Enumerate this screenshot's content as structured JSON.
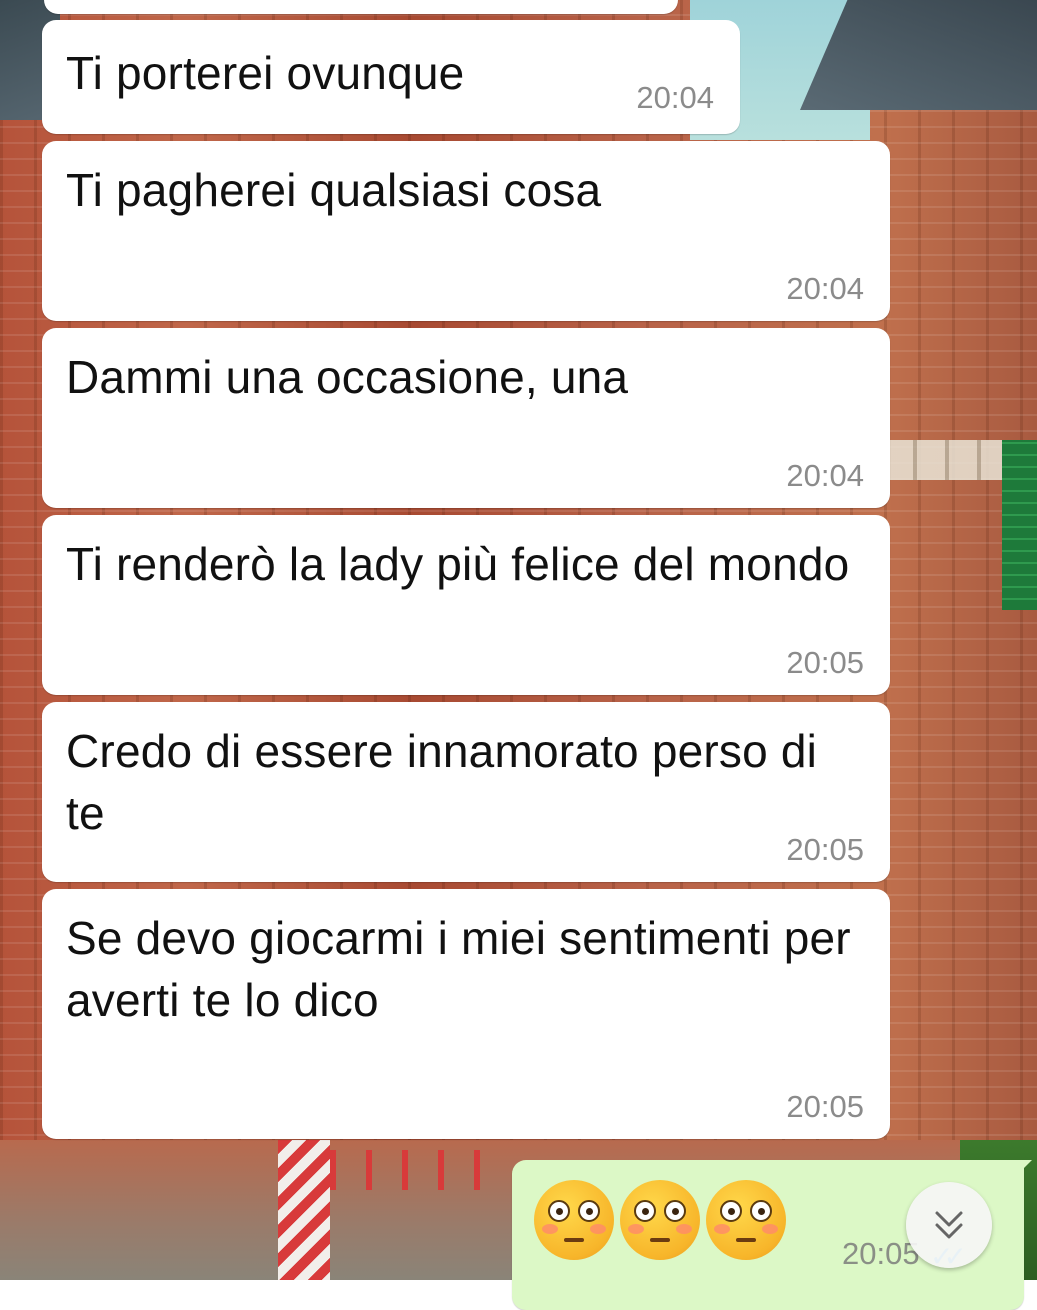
{
  "messages": [
    {
      "text": "Ti porterei ovunque",
      "time": "20:04"
    },
    {
      "text": "Ti pagherei qualsiasi cosa",
      "time": "20:04"
    },
    {
      "text": "Dammi una occasione, una",
      "time": "20:04"
    },
    {
      "text": "Ti renderò la lady più felice del mondo",
      "time": "20:05"
    },
    {
      "text": "Credo di essere innamorato perso di te",
      "time": "20:05"
    },
    {
      "text": "Se devo giocarmi i miei sentimenti per averti te lo dico",
      "time": "20:05"
    }
  ],
  "outgoing": {
    "emojis": [
      "flushed-face-icon",
      "flushed-face-icon",
      "flushed-face-icon"
    ],
    "time": "20:05",
    "status": "read"
  },
  "scroll_down": {
    "icon": "double-chevron-down-icon"
  },
  "colors": {
    "incoming_bubble": "#ffffff",
    "outgoing_bubble": "#dcf8c6",
    "timestamp": "#8b8b8b",
    "read_ticks": "#4fc3f7"
  }
}
